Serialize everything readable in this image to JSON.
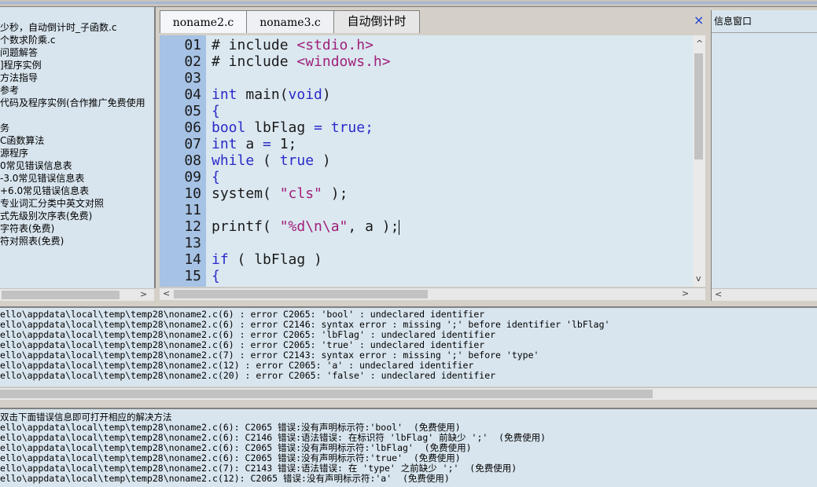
{
  "tree": {
    "items": [
      "少秒，自动倒计时_子函数.c",
      "个数求阶乘.c",
      "问题解答",
      "]程序实例",
      "方法指导",
      "参考",
      "代码及程序实例(合作推广免费使用",
      "",
      "务",
      "C函数算法",
      "源程序",
      "0常见错误信息表",
      "-3.0常见错误信息表",
      "+6.0常见错误信息表",
      "专业词汇分类中英文对照",
      "式先级别次序表(免费)",
      "字符表(免费)",
      "符对照表(免费)"
    ]
  },
  "editor": {
    "tabs": [
      "noname2.c",
      "noname3.c",
      "自动倒计时"
    ],
    "close_glyph": "×",
    "line_numbers": [
      "01",
      "02",
      "03",
      "04",
      "05",
      "06",
      "07",
      "08",
      "09",
      "10",
      "11",
      "12",
      "13",
      "14",
      "15"
    ],
    "lines": [
      [
        {
          "t": "# include ",
          "c": "n"
        },
        {
          "t": "<stdio.h>",
          "c": "str"
        }
      ],
      [
        {
          "t": "# include ",
          "c": "n"
        },
        {
          "t": "<windows.h>",
          "c": "str"
        }
      ],
      [],
      [
        {
          "t": "int",
          "c": "kw"
        },
        {
          "t": " main(",
          "c": "n"
        },
        {
          "t": "void",
          "c": "kw"
        },
        {
          "t": ")",
          "c": "n"
        }
      ],
      [
        {
          "t": "{",
          "c": "kw"
        }
      ],
      [
        {
          "t": "bool",
          "c": "kw"
        },
        {
          "t": " lbFlag ",
          "c": "n"
        },
        {
          "t": "=",
          "c": "kw"
        },
        {
          "t": " ",
          "c": "n"
        },
        {
          "t": "true",
          "c": "kw"
        },
        {
          "t": ";",
          "c": "kw"
        }
      ],
      [
        {
          "t": "int",
          "c": "kw"
        },
        {
          "t": " a ",
          "c": "n"
        },
        {
          "t": "=",
          "c": "kw"
        },
        {
          "t": " 1;",
          "c": "n"
        }
      ],
      [
        {
          "t": "while",
          "c": "kw"
        },
        {
          "t": " ( ",
          "c": "n"
        },
        {
          "t": "true",
          "c": "kw"
        },
        {
          "t": " )",
          "c": "n"
        }
      ],
      [
        {
          "t": "{",
          "c": "kw"
        }
      ],
      [
        {
          "t": "system( ",
          "c": "n"
        },
        {
          "t": "\"cls\"",
          "c": "str"
        },
        {
          "t": " );",
          "c": "n"
        }
      ],
      [],
      [
        {
          "t": "printf( ",
          "c": "n"
        },
        {
          "t": "\"%d\\n\\a\"",
          "c": "str"
        },
        {
          "t": ", a );",
          "c": "n"
        },
        {
          "t": "",
          "c": "cursor"
        }
      ],
      [],
      [
        {
          "t": "if",
          "c": "kw"
        },
        {
          "t": " ( lbFlag )",
          "c": "n"
        }
      ],
      [
        {
          "t": "{",
          "c": "kw"
        }
      ]
    ]
  },
  "info_window": {
    "title": "信息窗口"
  },
  "build_output": [
    "ello\\appdata\\local\\temp\\temp28\\noname2.c(6) : error C2065: 'bool' : undeclared identifier",
    "ello\\appdata\\local\\temp\\temp28\\noname2.c(6) : error C2146: syntax error : missing ';' before identifier 'lbFlag'",
    "ello\\appdata\\local\\temp\\temp28\\noname2.c(6) : error C2065: 'lbFlag' : undeclared identifier",
    "ello\\appdata\\local\\temp\\temp28\\noname2.c(6) : error C2065: 'true' : undeclared identifier",
    "ello\\appdata\\local\\temp\\temp28\\noname2.c(7) : error C2143: syntax error : missing ';' before 'type'",
    "ello\\appdata\\local\\temp\\temp28\\noname2.c(12) : error C2065: 'a' : undeclared identifier",
    "ello\\appdata\\local\\temp\\temp28\\noname2.c(20) : error C2065: 'false' : undeclared identifier"
  ],
  "help_output": [
    "双击下面错误信息即可打开相应的解决方法",
    "ello\\appdata\\local\\temp\\temp28\\noname2.c(6): C2065 错误:没有声明标示符:'bool'  (免费使用)",
    "ello\\appdata\\local\\temp\\temp28\\noname2.c(6): C2146 错误:语法错误: 在标识符 'lbFlag' 前缺少 ';'  (免费使用)",
    "ello\\appdata\\local\\temp\\temp28\\noname2.c(6): C2065 错误:没有声明标示符:'lbFlag'  (免费使用)",
    "ello\\appdata\\local\\temp\\temp28\\noname2.c(6): C2065 错误:没有声明标示符:'true'  (免费使用)",
    "ello\\appdata\\local\\temp\\temp28\\noname2.c(7): C2143 错误:语法错误: 在 'type' 之前缺少 ';'  (免费使用)",
    "ello\\appdata\\local\\temp\\temp28\\noname2.c(12): C2065 错误:没有声明标示符:'a'  (免费使用)"
  ],
  "scroll_glyphs": {
    "left": "<",
    "right": ">",
    "up": "^",
    "down": "v"
  }
}
